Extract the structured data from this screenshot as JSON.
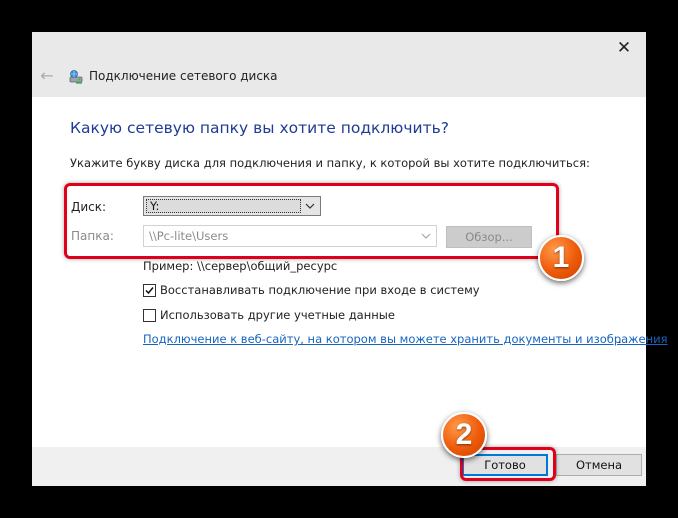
{
  "window": {
    "title": "Подключение сетевого диска",
    "close_glyph": "✕",
    "back_glyph": "←"
  },
  "main": {
    "heading": "Какую сетевую папку вы хотите подключить?",
    "instruction": "Укажите букву диска для подключения и папку, к которой вы хотите подключиться:",
    "drive_label": "Диск:",
    "drive_value": "Y:",
    "folder_label": "Папка:",
    "folder_value": "\\\\Pc-lite\\Users",
    "browse_label": "Обзор...",
    "example": "Пример: \\\\сервер\\общий_ресурс",
    "reconnect_label": "Восстанавливать подключение при входе в систему",
    "reconnect_checked": true,
    "other_creds_label": "Использовать другие учетные данные",
    "other_creds_checked": false,
    "link_text": "Подключение к веб-сайту, на котором вы можете хранить документы и изображения",
    "link_suffix": "."
  },
  "buttons": {
    "ok": "Готово",
    "cancel": "Отмена"
  },
  "annotations": {
    "badge_1": "1",
    "badge_2": "2",
    "highlight_color": "#e0001b",
    "badge_color": "#ee5a0a"
  },
  "colors": {
    "heading": "#1e3c95",
    "link": "#1565c0",
    "focus": "#0078d7"
  }
}
